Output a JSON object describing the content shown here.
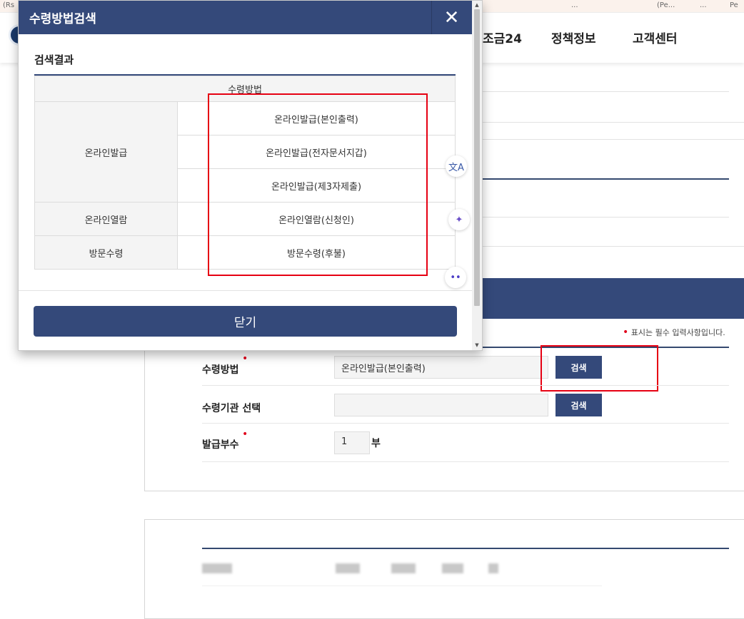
{
  "bookmarks": [
    "(Rs",
    "...",
    "(Pe...",
    "...",
    "Pe"
  ],
  "nav": [
    "조금24",
    "정책정보",
    "고객센터"
  ],
  "popup": {
    "title": "수령방법검색",
    "close_icon": "✕",
    "result_title": "검색결과",
    "table_header": "수령방법",
    "rows": [
      {
        "group": "온라인발급",
        "method": "온라인발급(본인출력)"
      },
      {
        "group": "",
        "method": "온라인발급(전자문서지갑)"
      },
      {
        "group": "",
        "method": "온라인발급(제3자제출)"
      },
      {
        "group": "온라인열람",
        "method": "온라인열람(신청인)"
      },
      {
        "group": "방문수령",
        "method": "방문수령(후불)"
      }
    ],
    "close_button": "닫기"
  },
  "form": {
    "required_note": "표시는 필수 입력사항입니다.",
    "fields": [
      {
        "label": "수령방법",
        "required": true,
        "value": "온라인발급(본인출력)",
        "button": "검색"
      },
      {
        "label": "수령기관 선택",
        "required": false,
        "value": "",
        "button": "검색"
      },
      {
        "label": "발급부수",
        "required": true,
        "value": "1",
        "unit": "부"
      }
    ]
  },
  "colors": {
    "primary": "#34497a",
    "highlight": "#e60012",
    "required": "#e0001b"
  }
}
